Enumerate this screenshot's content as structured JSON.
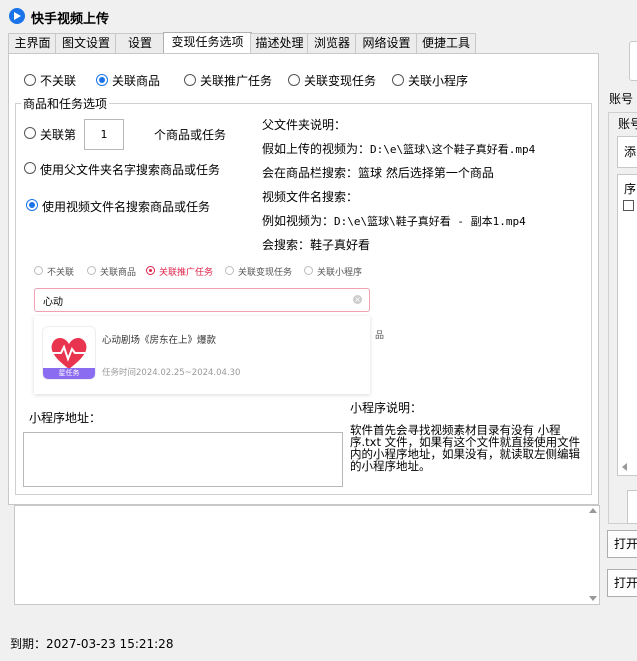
{
  "window": {
    "title": "快手视频上传"
  },
  "tabs": [
    {
      "label": "主界面"
    },
    {
      "label": "图文设置"
    },
    {
      "label": "设置"
    },
    {
      "label": "变现任务选项"
    },
    {
      "label": "描述处理"
    },
    {
      "label": "浏览器"
    },
    {
      "label": "网络设置"
    },
    {
      "label": "便捷工具"
    }
  ],
  "link_options": [
    {
      "label": "不关联",
      "selected": false
    },
    {
      "label": "关联商品",
      "selected": true
    },
    {
      "label": "关联推广任务",
      "selected": false
    },
    {
      "label": "关联变现任务",
      "selected": false
    },
    {
      "label": "关联小程序",
      "selected": false
    }
  ],
  "goods_group": {
    "title": "商品和任务选项",
    "option_nth_prefix": "关联第",
    "nth_value": "1",
    "option_nth_suffix": "个商品或任务",
    "option_folder": "使用父文件夹名字搜索商品或任务",
    "option_filename": "使用视频文件名搜索商品或任务",
    "selected": "filename"
  },
  "explain": {
    "heading": "父文件夹说明：",
    "line1_label": "假如上传的视频为：",
    "line1_path": "D:\\e\\篮球\\这个鞋子真好看.mp4",
    "line2": "会在商品栏搜索：篮球  然后选择第一个商品",
    "heading2": "视频文件名搜索：",
    "line3_label": "例如视频为：",
    "line3_path": "D:\\e\\篮球\\鞋子真好看 - 副本1.mp4",
    "line4": "会搜索：鞋子真好看"
  },
  "preview": {
    "options": [
      {
        "label": "不关联",
        "selected": false
      },
      {
        "label": "关联商品",
        "selected": false
      },
      {
        "label": "关联推广任务",
        "selected": true
      },
      {
        "label": "关联变现任务",
        "selected": false
      },
      {
        "label": "关联小程序",
        "selected": false
      }
    ],
    "search_value": "心动",
    "card_title": "心动剧场《房东在上》爆款",
    "card_badge": "星任务",
    "card_time": "任务时间2024.02.25~2024.04.30",
    "side_text": "品",
    "accent": "#e0224a"
  },
  "miniapp": {
    "address_label": "小程序地址：",
    "address_value": "",
    "explain_heading": "小程序说明：",
    "explain_text": "软件首先会寻找视频素材目录有没有 小程序.txt 文件，如果有这个文件就直接使用文件内的小程序地址，如果没有，就读取左侧编辑的小程序地址。"
  },
  "status": {
    "expiry": "到期：2027-03-23 15:21:28"
  },
  "right": {
    "account_label": "账号",
    "account_label2": "账号",
    "add_label": "添",
    "seq_label": "序",
    "open1": "打开",
    "open2": "打开"
  },
  "colors": {
    "accent": "#1a73e8"
  }
}
